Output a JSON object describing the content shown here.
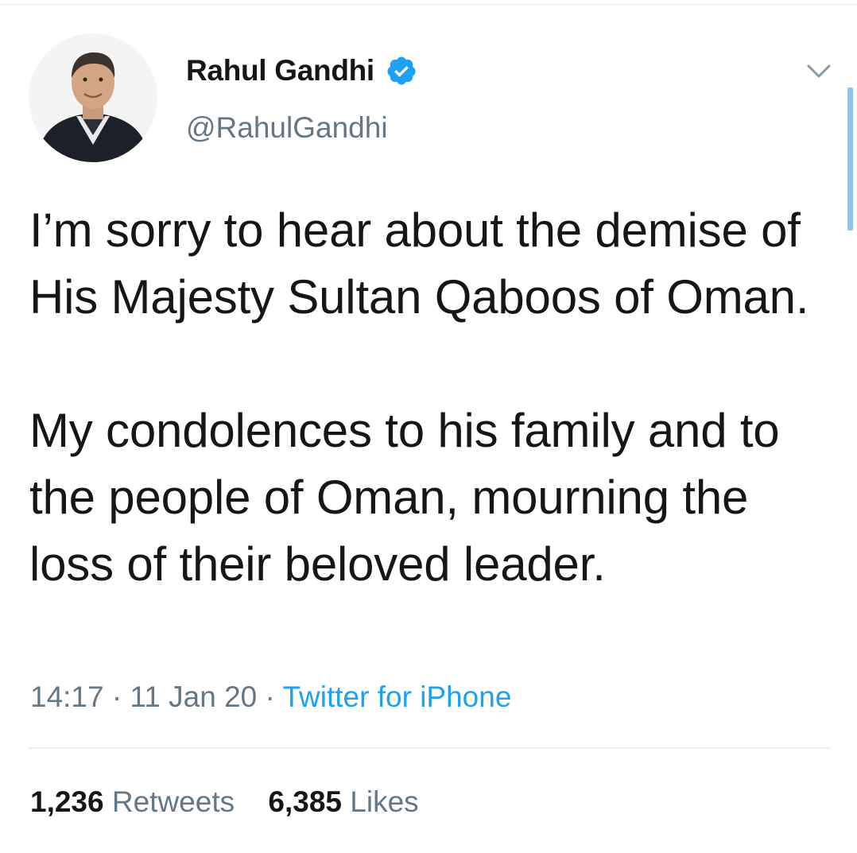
{
  "author": {
    "display_name": "Rahul Gandhi",
    "handle": "@RahulGandhi",
    "avatar_icon": "profile-photo",
    "verified_icon": "verified-badge-icon"
  },
  "tweet": {
    "paragraphs": [
      "I’m sorry to hear about the demise of His Majesty Sultan Qaboos of Oman.",
      "My condolences to his family and to the people of Oman, mourning the loss of their beloved leader."
    ],
    "time": "14:17",
    "separator": "·",
    "date": "11 Jan 20",
    "source": "Twitter for iPhone"
  },
  "stats": {
    "retweets_count": "1,236",
    "retweets_label": "Retweets",
    "likes_count": "6,385",
    "likes_label": "Likes"
  },
  "colors": {
    "accent": "#1da1f2",
    "text": "#14171a",
    "secondary_text": "#657786",
    "divider": "#e6ecf0"
  }
}
